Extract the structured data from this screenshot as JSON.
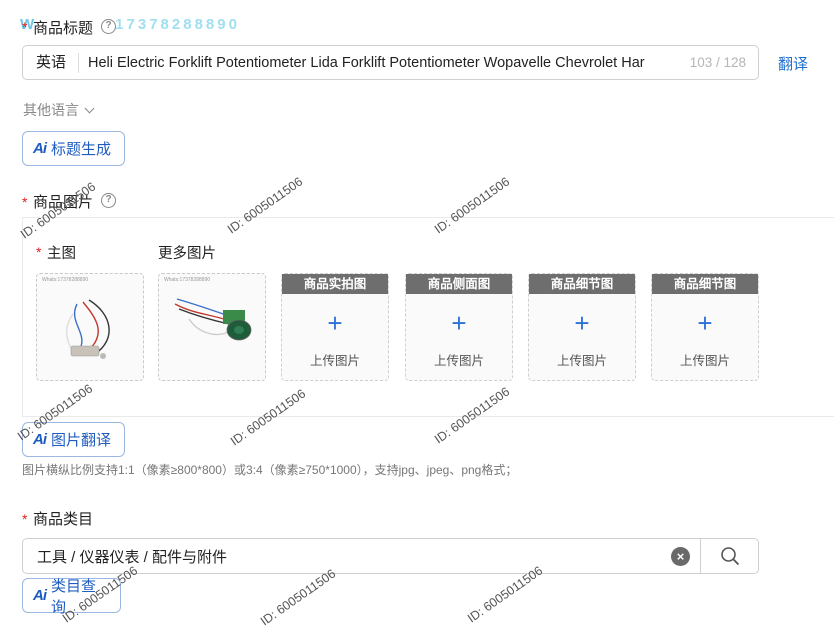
{
  "watermark_phone": "17378288890",
  "watermark_id": "ID: 6005011506",
  "title_section": {
    "required_mark": "*",
    "label": "商品标题",
    "lang": "英语",
    "value": "Heli Electric Forklift Potentiometer Lida Forklift Potentiometer Wopavelle Chevrolet Har",
    "count": "103 / 128",
    "translate": "翻译",
    "other_lang": "其他语言",
    "ai_button": "标题生成"
  },
  "image_section": {
    "required_mark": "*",
    "label": "商品图片",
    "main_label": "主图",
    "more_label": "更多图片",
    "thumb_watermark": "Whats:17378288890",
    "slots": [
      {
        "title": "商品实拍图",
        "upload": "上传图片"
      },
      {
        "title": "商品侧面图",
        "upload": "上传图片"
      },
      {
        "title": "商品细节图",
        "upload": "上传图片"
      },
      {
        "title": "商品细节图",
        "upload": "上传图片"
      }
    ],
    "ai_button": "图片翻译",
    "hint": "图片横纵比例支持1:1（像素≥800*800）或3:4（像素≥750*1000），支持jpg、jpeg、png格式；"
  },
  "category_section": {
    "required_mark": "*",
    "label": "商品类目",
    "value": "工具 / 仪器仪表 / 配件与附件",
    "ai_button": "类目查询"
  },
  "icons": {
    "ai": "Ai",
    "help": "?",
    "plus": "+",
    "clear": "×"
  },
  "colors": {
    "accent": "#1f6fd1",
    "required": "#e02020",
    "slot_header": "#6e6e6e"
  }
}
